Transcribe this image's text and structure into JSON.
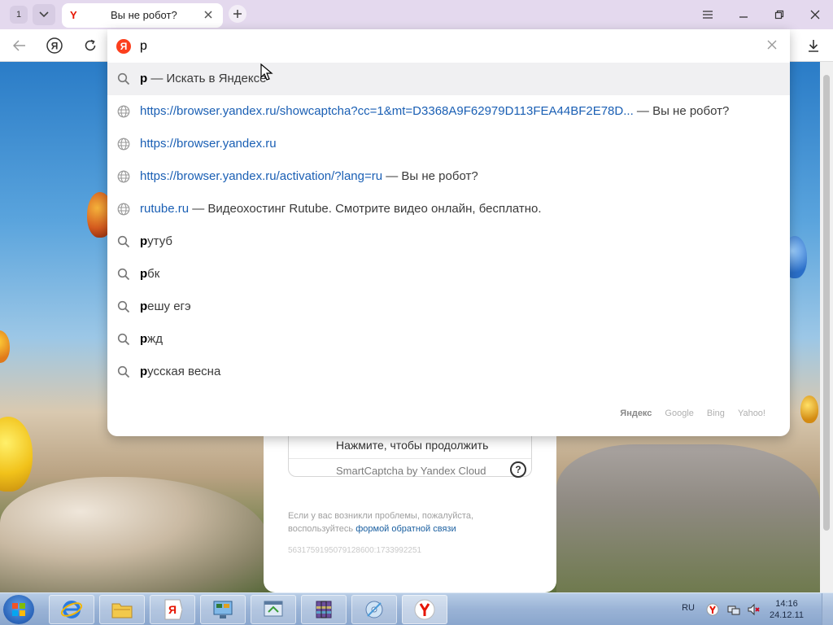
{
  "titlebar": {
    "tab_count": "1",
    "tab": {
      "title": "Вы не робот?",
      "favicon": "Y"
    }
  },
  "omnibox": {
    "value": "р",
    "logo": "Я",
    "suggestions": [
      {
        "kind": "search",
        "bold": "р",
        "rest": " — Искать в Яндексе",
        "active": true
      },
      {
        "kind": "history",
        "url": "https://browser.yandex.ru/showcaptcha?cc=1&mt=D3368A9F62979D113FEA44BF2E78D...",
        "desc": " — Вы не робот?"
      },
      {
        "kind": "history",
        "url": "https://browser.yandex.ru",
        "desc": ""
      },
      {
        "kind": "history",
        "url": "https://browser.yandex.ru/activation/?lang=ru",
        "desc": " — Вы не робот?"
      },
      {
        "kind": "history",
        "url": "rutube.ru",
        "desc": " — Видеохостинг Rutube. Смотрите видео онлайн, бесплатно."
      },
      {
        "kind": "search",
        "bold": "р",
        "rest": "утуб"
      },
      {
        "kind": "search",
        "bold": "р",
        "rest": "бк"
      },
      {
        "kind": "search",
        "bold": "р",
        "rest": "ешу егэ"
      },
      {
        "kind": "search",
        "bold": "р",
        "rest": "жд"
      },
      {
        "kind": "search",
        "bold": "р",
        "rest": "усская весна"
      }
    ],
    "engines": [
      "Яндекс",
      "Google",
      "Bing",
      "Yahoo!"
    ],
    "selected_engine": "Яндекс"
  },
  "captcha": {
    "cta": "Нажмите, чтобы продолжить",
    "brand": "SmartCaptcha by Yandex Cloud",
    "help": "?",
    "note_prefix": "Если у вас возникли проблемы, пожалуйста, воспользуйтесь",
    "note_link": "формой обратной связи",
    "request_id": "5631759195079128600:1733992251"
  },
  "taskbar": {
    "lang": "RU",
    "time": "14:16",
    "date": "24.12.11"
  },
  "colors": {
    "accent_red": "#fc3f1d",
    "link_blue": "#1a5fb4",
    "chrome_bg": "#e4d9ee"
  }
}
